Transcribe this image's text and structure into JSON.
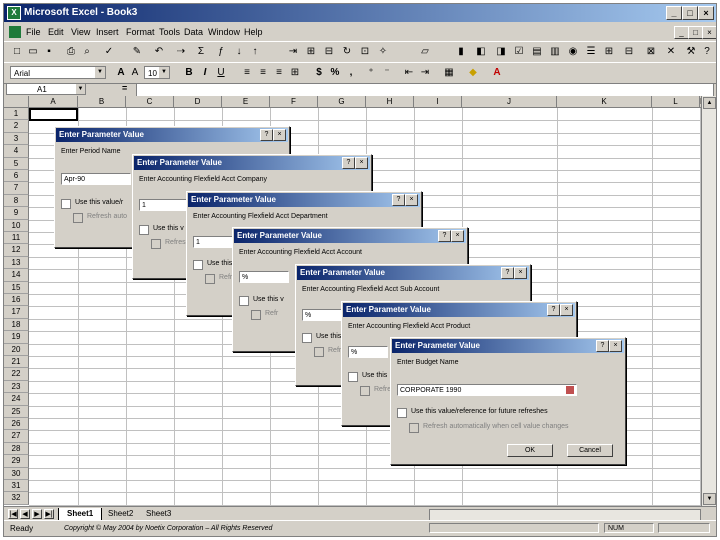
{
  "window": {
    "title": "Microsoft Excel - Book3",
    "controls": [
      "_",
      "□",
      "×"
    ]
  },
  "menu": [
    "File",
    "Edit",
    "View",
    "Insert",
    "Format",
    "Tools",
    "Data",
    "Window",
    "Help"
  ],
  "formatting": {
    "font": "Arial",
    "size": "10",
    "bold": "B",
    "italic": "I",
    "underline": "U",
    "currency": "$",
    "percent": "%",
    "comma": ","
  },
  "formula_bar": {
    "cell": "A1",
    "equals": "=",
    "value": ""
  },
  "grid": {
    "columns": [
      "A",
      "B",
      "C",
      "D",
      "E",
      "F",
      "G",
      "H",
      "I",
      "J",
      "K",
      "L",
      "M",
      "N"
    ],
    "rows": [
      "1",
      "2",
      "3",
      "4",
      "5",
      "6",
      "7",
      "8",
      "9",
      "10",
      "11",
      "12",
      "13",
      "14",
      "15",
      "16",
      "17",
      "18",
      "19",
      "20",
      "21",
      "22",
      "23",
      "24",
      "25",
      "26",
      "27",
      "28",
      "29",
      "30",
      "31",
      "32"
    ]
  },
  "sheets": [
    "Sheet1",
    "Sheet2",
    "Sheet3"
  ],
  "status": {
    "ready": "Ready",
    "copyright": "Copyright © May 2004 by Noetix Corporation – All Rights Reserved",
    "num": "NUM"
  },
  "dialogs": [
    {
      "title": "Enter Parameter Value",
      "prompt": "Enter Period Name",
      "value": "Apr-90",
      "use_label": "Use this value/r",
      "refresh_label": "Refresh auto"
    },
    {
      "title": "Enter Parameter Value",
      "prompt": "Enter Accounting Flexfield Acct Company",
      "value": "1",
      "use_label": "Use this v",
      "refresh_label": "Refres"
    },
    {
      "title": "Enter Parameter Value",
      "prompt": "Enter Accounting Flexfield Acct Department",
      "value": "1",
      "use_label": "Use this v",
      "refresh_label": "Refr"
    },
    {
      "title": "Enter Parameter Value",
      "prompt": "Enter Accounting Flexfield Acct Account",
      "value": "%",
      "use_label": "Use this v",
      "refresh_label": "Refr"
    },
    {
      "title": "Enter Parameter Value",
      "prompt": "Enter Accounting Flexfield Acct Sub Account",
      "value": "%",
      "use_label": "Use this val",
      "refresh_label": "Refres"
    },
    {
      "title": "Enter Parameter Value",
      "prompt": "Enter Accounting Flexfield Acct Product",
      "value": "%",
      "use_label": "Use this",
      "refresh_label": "Refre"
    },
    {
      "title": "Enter Parameter Value",
      "prompt": "Enter Budget Name",
      "value": "CORPORATE 1990",
      "use_label": "Use this value/reference for future refreshes",
      "refresh_label": "Refresh automatically when cell value changes",
      "ok": "OK",
      "cancel": "Cancel"
    }
  ]
}
